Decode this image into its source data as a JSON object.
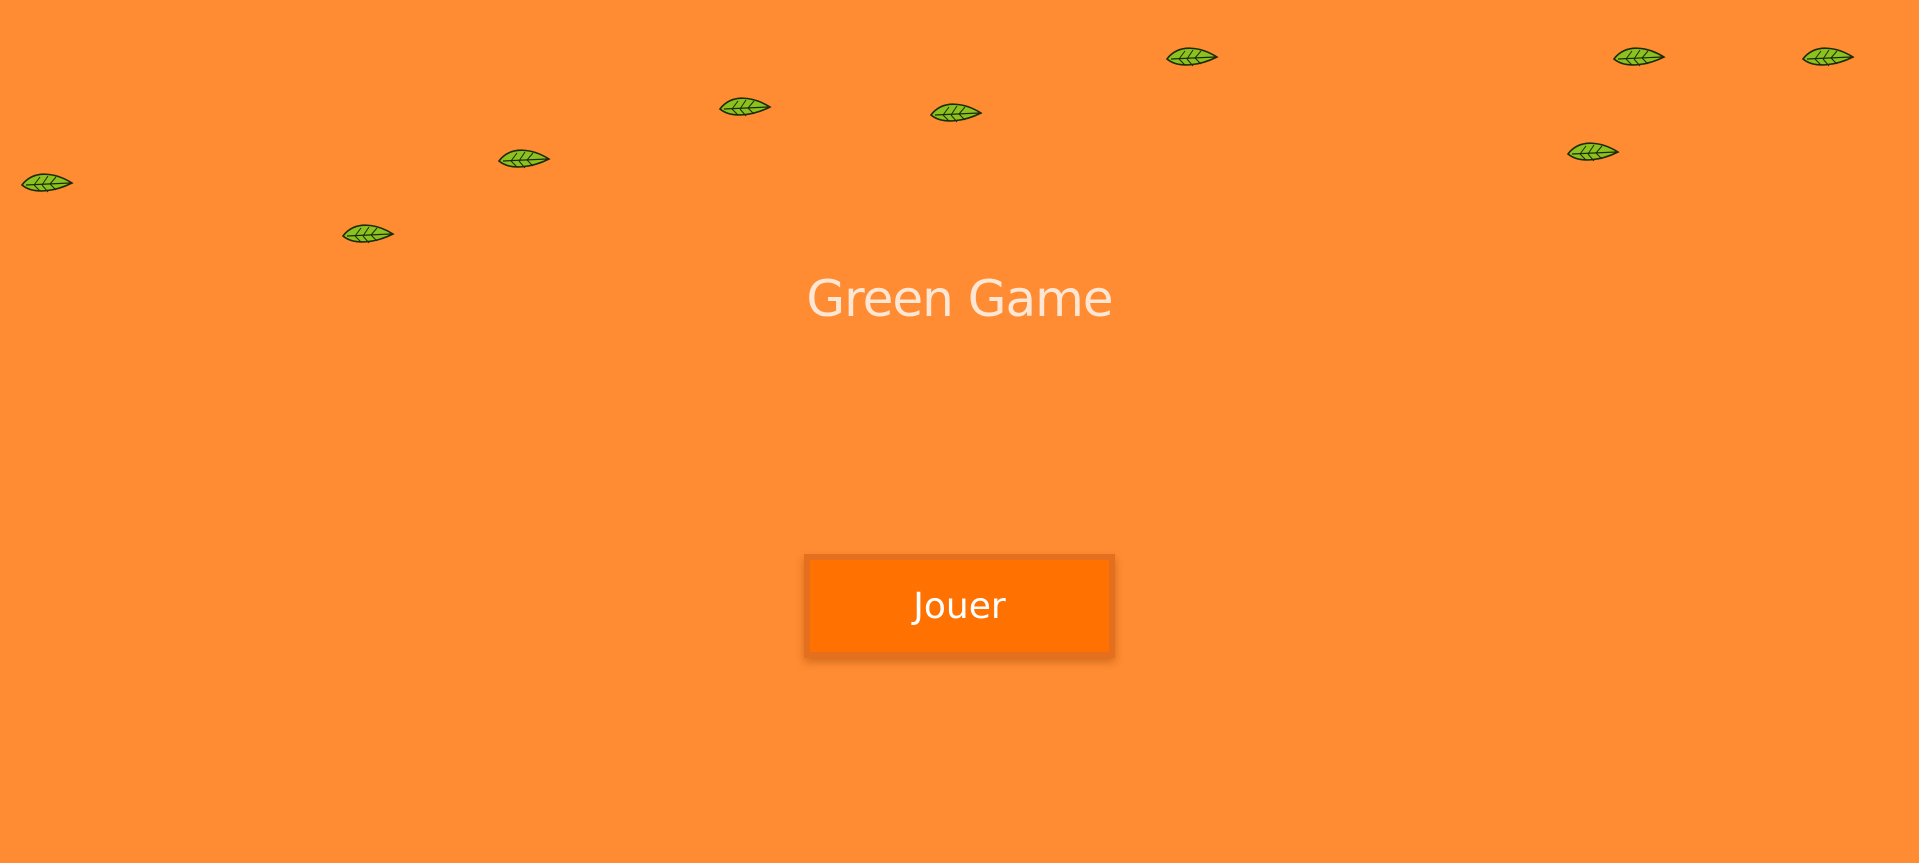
{
  "game": {
    "title": "Green Game",
    "play_label": "Jouer"
  },
  "colors": {
    "background": "#ff8c33",
    "title": "#fde6d3",
    "button": "#ff7100",
    "button_border": "#e4701f",
    "leaf": "#8cc21f"
  },
  "decor": {
    "icon": "leaf-icon",
    "leaf_count": 10
  }
}
